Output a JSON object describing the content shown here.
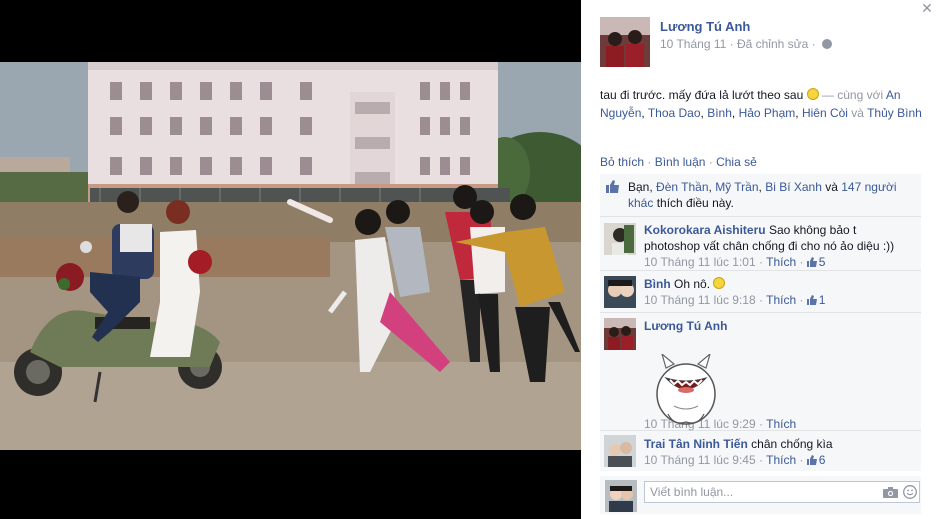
{
  "photo": {
    "alt_icon": "photo-image"
  },
  "panel": {
    "close_icon": "close-icon",
    "owner": {
      "name": "Lương Tú Anh"
    },
    "meta": {
      "date": "10 Tháng 11",
      "sep": " · ",
      "edited": "Đã chỉnh sửa",
      "sep2": " · "
    },
    "caption": {
      "text": "tau đi trước. mấy đứa lả lướt theo sau ",
      "with_prefix": " — cùng với ",
      "tagged": [
        "An Nguyễn",
        "Thoa Dao",
        "Bình",
        "Hảo Phạm",
        "Hiên Còi"
      ],
      "and_word": " và ",
      "last_tagged": "Thủy Bình"
    },
    "actions": {
      "unlike": "Bỏ thích",
      "comment": "Bình luận",
      "share": "Chia sẻ",
      "sep": " · "
    },
    "likes": {
      "prefix": "Bạn, ",
      "names": [
        "Đèn Thần",
        "Mỹ Trần",
        "Bi Bí Xanh"
      ],
      "and_word": " và ",
      "others": "147 người khác",
      "suffix": " thích điều này."
    },
    "comments": [
      {
        "author": "Kokorokara Aishiteru",
        "text": "Sao không bảo t photoshop vất chân chống đi cho nó ảo diệu :))",
        "time": "10 Tháng 11 lúc 1:01",
        "like_label": "Thích",
        "likes": "5"
      },
      {
        "author": "Bình",
        "text": "Oh nô. ",
        "time": "10 Tháng 11 lúc 9:18",
        "like_label": "Thích",
        "likes": "1"
      },
      {
        "author": "Lương Tú Anh",
        "text": "",
        "time": "10 Tháng 11 lúc 9:29",
        "like_label": "Thích",
        "likes": ""
      },
      {
        "author": "Trai Tân Ninh Tiến",
        "text": "chân chống kìa",
        "time": "10 Tháng 11 lúc 9:45",
        "like_label": "Thích",
        "likes": "6"
      }
    ],
    "composer": {
      "placeholder": "Viết bình luận..."
    }
  },
  "colors": {
    "link": "#3b5998",
    "meta": "#9197a3",
    "ufi_bg": "#f6f7f8"
  }
}
